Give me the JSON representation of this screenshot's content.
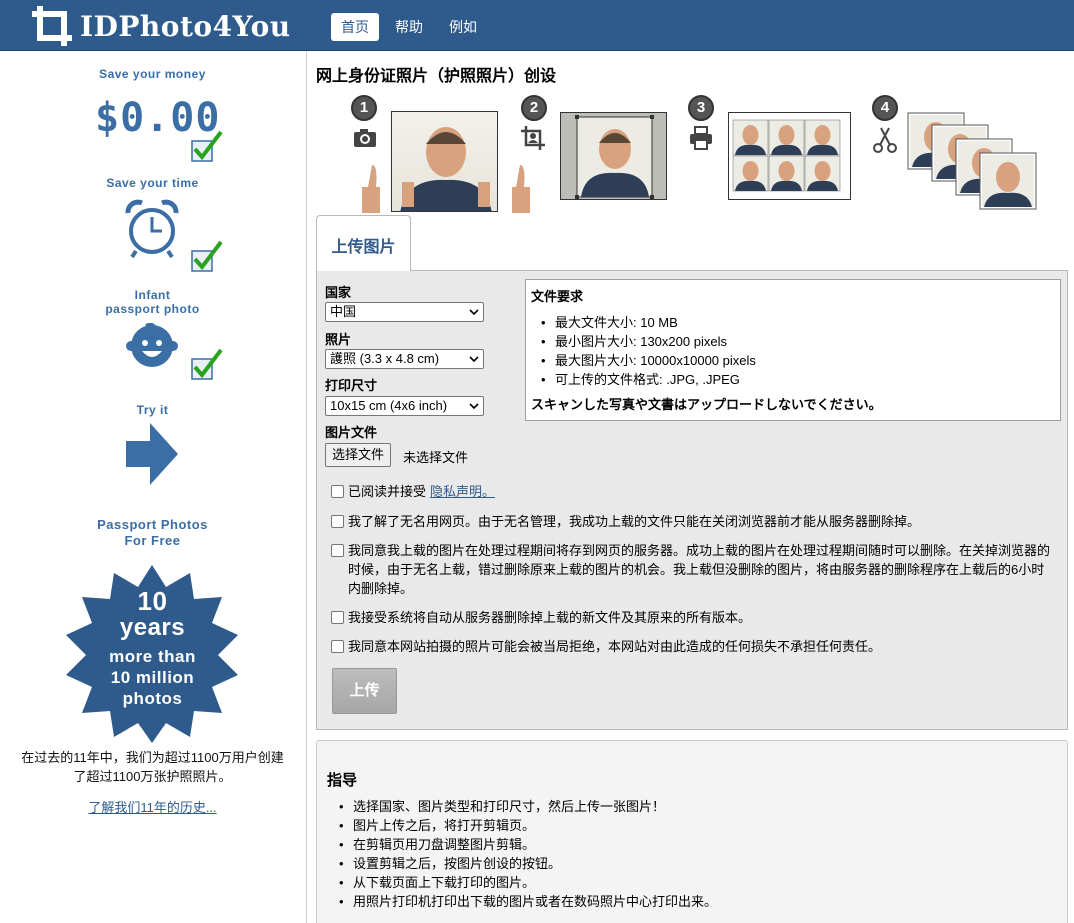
{
  "header": {
    "logo_text": "IDPhoto4You",
    "nav": [
      {
        "label": "首页",
        "active": true
      },
      {
        "label": "帮助",
        "active": false
      },
      {
        "label": "例如",
        "active": false
      }
    ]
  },
  "sidebar": {
    "save_money": "Save your money",
    "price": "$0.00",
    "save_time": "Save your time",
    "infant_line1": "Infant",
    "infant_line2": "passport photo",
    "try_it": "Try it",
    "free_line1": "Passport Photos",
    "free_line2": "For Free",
    "badge": {
      "line1": "10",
      "line2": "years",
      "line3": "more than",
      "line4": "10 million",
      "line5": "photos"
    },
    "history_text_line1": "在过去的11年中，我们为超过1100万用户创建",
    "history_text_line2": "了超过1100万张护照照片。",
    "history_link": "了解我们11年的历史..."
  },
  "main": {
    "title": "网上身份证照片（护照照片）创设",
    "steps": [
      "1",
      "2",
      "3",
      "4"
    ]
  },
  "upload": {
    "tab_label": "上传图片",
    "country_label": "国家",
    "country_value": "中国",
    "photo_label": "照片",
    "photo_value": "護照 (3.3 x 4.8 cm)",
    "print_label": "打印尺寸",
    "print_value": "10x15 cm (4x6 inch)",
    "file_label": "图片文件",
    "file_button": "选择文件",
    "file_none": "未选择文件",
    "requirements": {
      "title": "文件要求",
      "items": [
        "最大文件大小: 10 MB",
        "最小图片大小: 130x200 pixels",
        "最大图片大小: 10000x10000 pixels",
        "可上传的文件格式: .JPG, .JPEG"
      ],
      "warning": "スキャンした写真や文書はアップロードしないでください。"
    },
    "agree1_text": "已阅读并接受",
    "agree1_link": "隐私声明。",
    "agree2": "我了解了无名用网页。由于无名管理，我成功上载的文件只能在关闭浏览器前才能从服务器删除掉。",
    "agree3": "我同意我上载的图片在处理过程期间将存到网页的服务器。成功上载的图片在处理过程期间随时可以删除。在关掉浏览器的时候，由于无名上载，错过删除原来上载的图片的机会。我上载但没删除的图片，将由服务器的删除程序在上载后的6小时内删除掉。",
    "agree4": "我接受系统将自动从服务器删除掉上载的新文件及其原来的所有版本。",
    "agree5": "我同意本网站拍摄的照片可能会被当局拒绝，本网站对由此造成的任何损失不承担任何责任。",
    "upload_button": "上传"
  },
  "guide": {
    "title": "指导",
    "items": [
      "选择国家、图片类型和打印尺寸，然后上传一张图片！",
      "图片上传之后，将打开剪辑页。",
      "在剪辑页用刀盘调整图片剪辑。",
      "设置剪辑之后，按图片创设的按钮。",
      "从下载页面上下载打印的图片。",
      "用照片打印机打印出下载的图片或者在数码照片中心打印出来。"
    ]
  },
  "colors": {
    "brand": "#2e5b8c",
    "accent": "#3a6ea5",
    "check_green": "#2aa21e"
  }
}
